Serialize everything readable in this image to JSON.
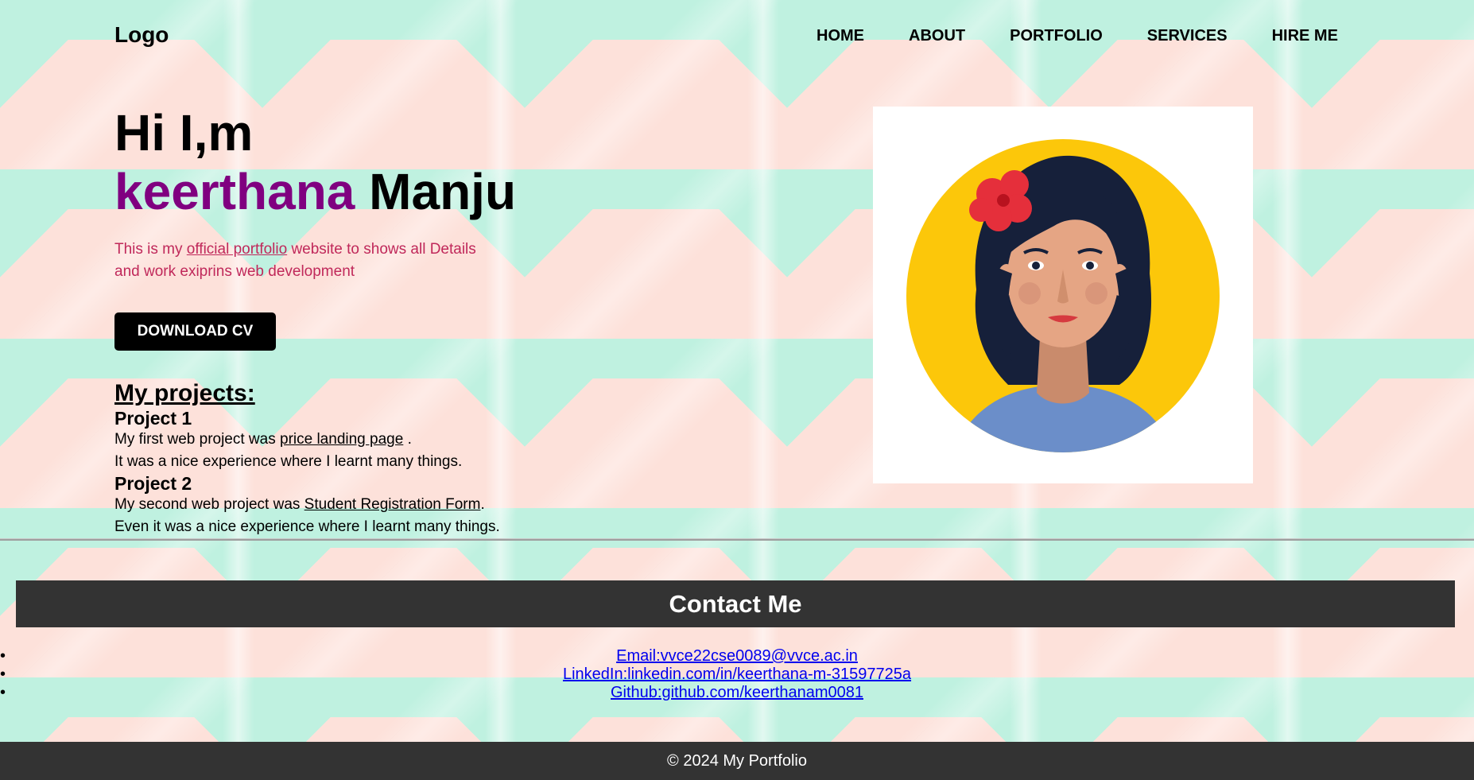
{
  "header": {
    "logo": "Logo",
    "nav": [
      "HOME",
      "ABOUT",
      "PORTFOLIO",
      "SERVICES",
      "HIRE ME"
    ]
  },
  "hero": {
    "greeting": "Hi I,m",
    "first_name": "keerthana",
    "last_name": "Manju",
    "tagline_pre": "This is my ",
    "tagline_link": "official portfolio",
    "tagline_post": " website to shows all Details and work exiprins web development",
    "cv_button": "DOWNLOAD CV"
  },
  "projects": {
    "heading": "My projects:",
    "items": [
      {
        "title": "Project 1",
        "line1_pre": "My first web project was ",
        "link": "price landing page",
        "line1_post": " .",
        "line2": "It was a nice experience where I learnt many things."
      },
      {
        "title": "Project 2",
        "line1_pre": "My second web project was ",
        "link": "Student Registration Form",
        "line1_post": ".",
        "line2": "Even it was a nice experience where I learnt many things."
      }
    ]
  },
  "contact": {
    "heading": "Contact Me",
    "links": [
      "Email:vvce22cse0089@vvce.ac.in",
      "LinkedIn:linkedin.com/in/keerthana-m-31597725a",
      "Github:github.com/keerthanam0081"
    ]
  },
  "footer": {
    "text": "© 2024 My Portfolio"
  },
  "colors": {
    "accent_name": "#800080",
    "tagline": "#c0285a",
    "bar": "#333333",
    "link": "#0000ee",
    "avatar_circle": "#fcc70a",
    "avatar_hair": "#16203a",
    "avatar_shirt": "#6b8ec9",
    "avatar_flower": "#e52f3b"
  }
}
